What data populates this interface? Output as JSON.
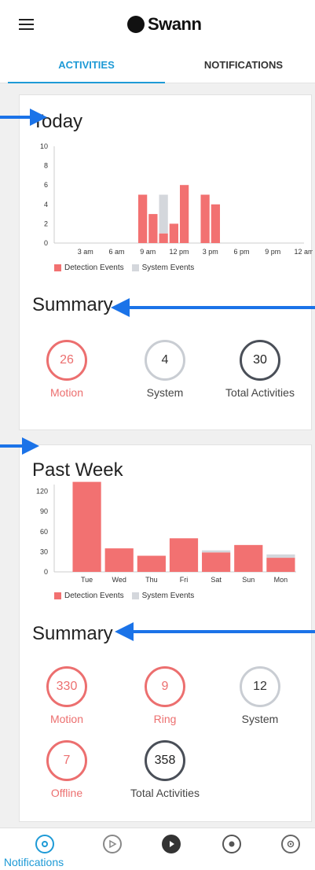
{
  "header": {
    "brand": "Swann"
  },
  "tabs": [
    {
      "label": "ACTIVITIES",
      "active": true
    },
    {
      "label": "NOTIFICATIONS",
      "active": false
    }
  ],
  "today": {
    "title": "Today",
    "summary_title": "Summary",
    "stats": [
      {
        "value": "26",
        "label": "Motion"
      },
      {
        "value": "4",
        "label": "System"
      },
      {
        "value": "30",
        "label": "Total Activities"
      }
    ]
  },
  "past_week": {
    "title": "Past Week",
    "summary_title": "Summary",
    "stats": [
      {
        "value": "330",
        "label": "Motion"
      },
      {
        "value": "9",
        "label": "Ring"
      },
      {
        "value": "12",
        "label": "System"
      },
      {
        "value": "7",
        "label": "Offline"
      },
      {
        "value": "358",
        "label": "Total Activities"
      }
    ]
  },
  "legend": {
    "detection": "Detection Events",
    "system": "System  Events"
  },
  "colors": {
    "detection": "#f27171",
    "system": "#d4d7dc",
    "accent": "#1e9ad6",
    "arrow": "#1b73e8"
  },
  "bottom_nav": {
    "active_label": "Notifications",
    "icons": [
      "notifications-icon",
      "playback-icon",
      "live-play-icon",
      "globe-shield-icon",
      "settings-icon"
    ]
  },
  "chart_data": [
    {
      "type": "bar",
      "stacked": true,
      "ylim": [
        0,
        10
      ],
      "yticks": [
        0,
        2,
        4,
        6,
        8,
        10
      ],
      "x": [
        8,
        9,
        10,
        11,
        12,
        14,
        15
      ],
      "xlim": [
        0,
        24
      ],
      "xticks": [
        "3 am",
        "6 am",
        "9 am",
        "12 pm",
        "3 pm",
        "6 pm",
        "9 pm",
        "12 am"
      ],
      "series": [
        {
          "name": "Detection Events",
          "values": [
            5,
            3,
            1,
            2,
            6,
            5,
            4
          ]
        },
        {
          "name": "System  Events",
          "values": [
            0,
            0,
            4,
            0,
            0,
            0,
            0
          ]
        }
      ],
      "legend": "bottom"
    },
    {
      "type": "bar",
      "stacked": true,
      "ylim": [
        0,
        130
      ],
      "yticks": [
        0,
        30,
        60,
        90,
        120
      ],
      "categories": [
        "Tue",
        "Wed",
        "Thu",
        "Fri",
        "Sat",
        "Sun",
        "Mon"
      ],
      "series": [
        {
          "name": "Detection Events",
          "values": [
            134,
            35,
            24,
            50,
            29,
            40,
            21
          ]
        },
        {
          "name": "System  Events",
          "values": [
            0,
            0,
            0,
            0,
            3,
            0,
            5
          ]
        }
      ],
      "legend": "bottom"
    }
  ]
}
